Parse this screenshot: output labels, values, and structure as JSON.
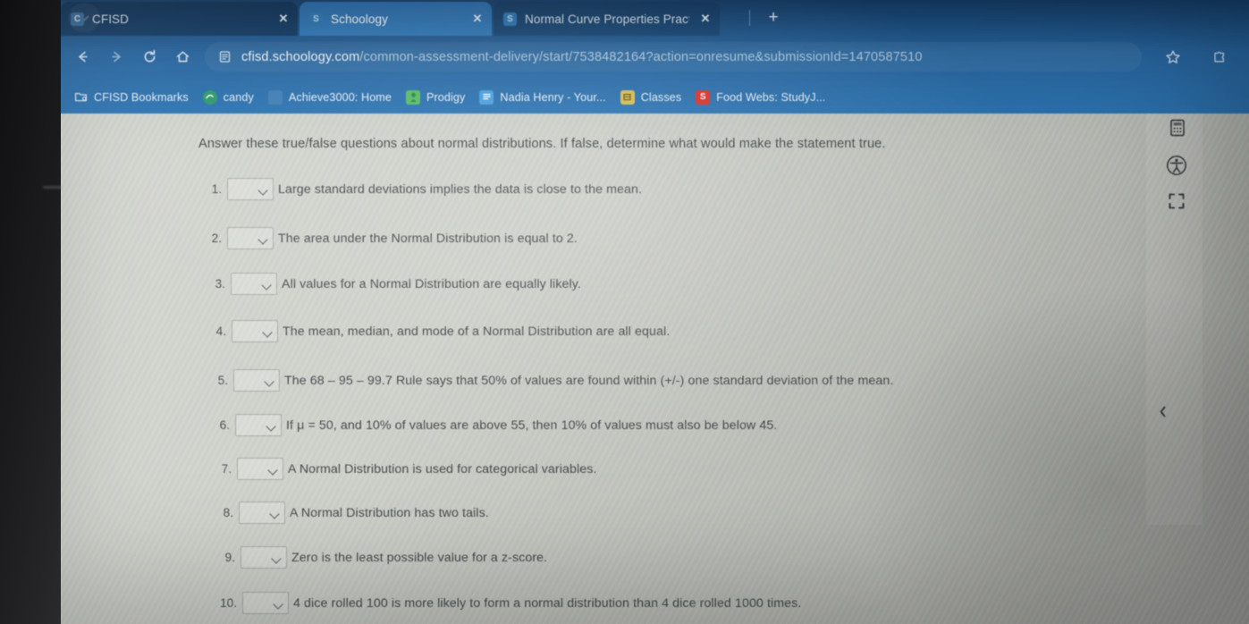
{
  "browser": {
    "tabs": [
      {
        "title": "CFISD",
        "favicon_name": "cfisd-favicon",
        "favicon_text": "C",
        "favicon_bg": "#3b6fa0",
        "close_label": "✕",
        "active": false
      },
      {
        "title": "Schoology",
        "favicon_name": "schoology-favicon",
        "favicon_text": "S",
        "favicon_bg": "#2f7bb8",
        "close_label": "✕",
        "active": true
      },
      {
        "title": "Normal Curve Properties Pract",
        "favicon_name": "schoology-favicon",
        "favicon_text": "S",
        "favicon_bg": "#2f7bb8",
        "close_label": "✕",
        "active": false
      }
    ],
    "new_tab_label": "+",
    "tab_list_label": "⌄",
    "nav": {
      "back_label": "←",
      "forward_label": "→",
      "reload_label": "⟳",
      "home_label": "⌂"
    },
    "omnibox": {
      "host": "cfisd.schoology.com",
      "path": "/common-assessment-delivery/start/7538482164?action=onresume&submissionId=1470587510",
      "full_url": "cfisd.schoology.com/common-assessment-delivery/start/7538482164?action=onresume&submissionId=1470587510",
      "site_icon_name": "page-info-icon",
      "star_label": "☆",
      "extensions_label": "⬚"
    },
    "bookmarks": [
      {
        "label": "CFISD Bookmarks",
        "icon_name": "folder-icon",
        "icon_text": "▤",
        "icon_bg": "transparent"
      },
      {
        "label": "candy",
        "icon_name": "candy-favicon",
        "icon_text": "●",
        "icon_bg": "#2f9e6e"
      },
      {
        "label": "Achieve3000: Home",
        "icon_name": "achieve3000-favicon",
        "icon_text": "",
        "icon_bg": "rgba(255,255,255,0.10)"
      },
      {
        "label": "Prodigy",
        "icon_name": "prodigy-favicon",
        "icon_text": "♟",
        "icon_bg": "#5bbf6a"
      },
      {
        "label": "Nadia Henry - Your...",
        "icon_name": "docs-favicon",
        "icon_text": "≡",
        "icon_bg": "#4ba3e3"
      },
      {
        "label": "Classes",
        "icon_name": "classroom-favicon",
        "icon_text": "▦",
        "icon_bg": "#d9c15a"
      },
      {
        "label": "Food Webs: StudyJ...",
        "icon_name": "studyjams-favicon",
        "icon_text": "S",
        "icon_bg": "#e0352b"
      }
    ]
  },
  "assessment": {
    "instructions": "Answer these true/false questions about normal distributions. If false, determine what would make the statement true.",
    "select_placeholder": "",
    "questions": [
      {
        "number": "1.",
        "answer": "",
        "text": "Large standard deviations implies the data is close to the mean."
      },
      {
        "number": "2.",
        "answer": "",
        "text": "The area under the Normal Distribution is equal to 2."
      },
      {
        "number": "3.",
        "answer": "",
        "text": "All values for a Normal Distribution are equally likely."
      },
      {
        "number": "4.",
        "answer": "",
        "text": "The mean, median, and mode of a Normal Distribution are all equal."
      },
      {
        "number": "5.",
        "answer": "",
        "text": "The 68 – 95 – 99.7 Rule says that 50% of values are found within (+/-) one standard deviation of the mean."
      },
      {
        "number": "6.",
        "answer": "",
        "text": "If μ = 50, and 10% of values are above 55, then 10% of values must also be below 45."
      },
      {
        "number": "7.",
        "answer": "",
        "text": "A Normal Distribution is used for categorical variables."
      },
      {
        "number": "8.",
        "answer": "",
        "text": "A Normal Distribution has two tails."
      },
      {
        "number": "9.",
        "answer": "",
        "text": "Zero is the least possible value for a z-score."
      },
      {
        "number": "10.",
        "answer": "",
        "text": "4 dice rolled 100 is more likely to form a normal distribution than 4 dice rolled 1000 times."
      }
    ]
  },
  "rail": {
    "calculator_label": "▤",
    "accessibility_label": "ⓘ",
    "expand_label": "⬚",
    "collapse_label": "‹"
  },
  "colors": {
    "chrome_blue": "#2a6ba8",
    "active_tab_blue": "#3480c2",
    "page_gray": "#cdcfc9",
    "text_gray": "#43494d",
    "bezel_dark": "#1a1a1c"
  }
}
